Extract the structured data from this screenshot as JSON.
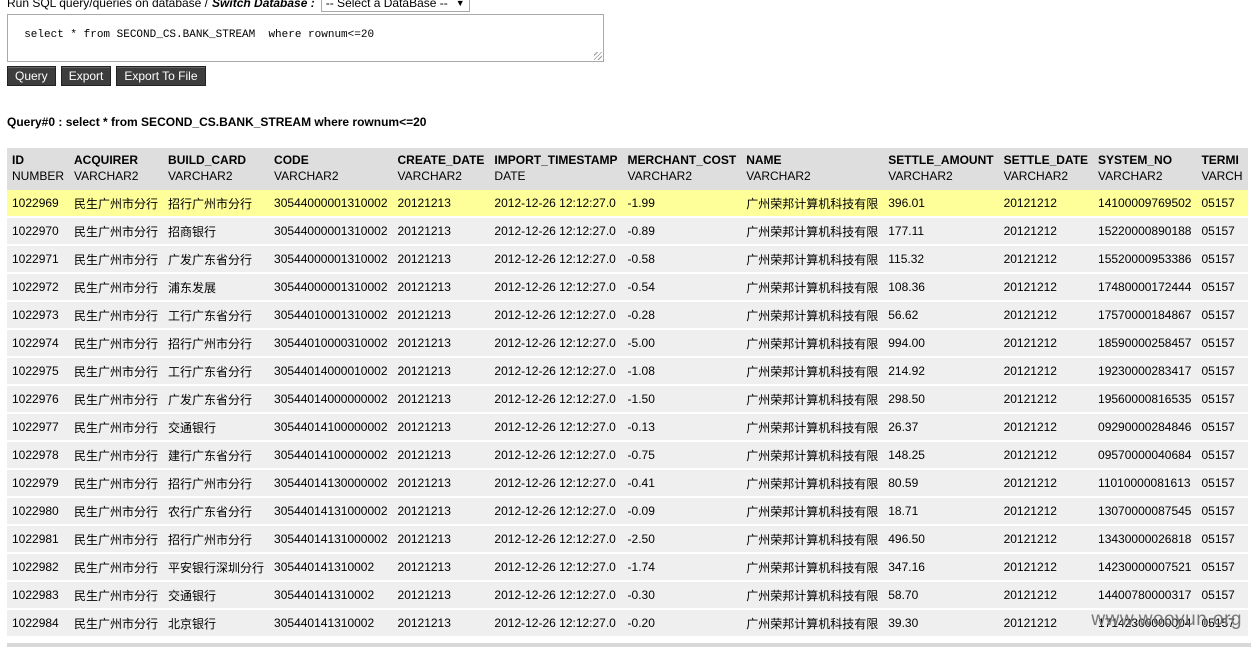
{
  "header": {
    "run_label": "Run SQL query/queries on database /",
    "switch_label": "Switch Database :",
    "db_select_value": "-- Select a DataBase --"
  },
  "sql_input": {
    "value": "select * from SECOND_CS.BANK_STREAM  where rownum<=20"
  },
  "buttons": {
    "query": "Query",
    "export": "Export",
    "export_file": "Export To File"
  },
  "result": {
    "label": "Query#0 : select * from SECOND_CS.BANK_STREAM where rownum<=20"
  },
  "columns": [
    {
      "name": "ID",
      "type": "NUMBER"
    },
    {
      "name": "ACQUIRER",
      "type": "VARCHAR2"
    },
    {
      "name": "BUILD_CARD",
      "type": "VARCHAR2"
    },
    {
      "name": "CODE",
      "type": "VARCHAR2"
    },
    {
      "name": "CREATE_DATE",
      "type": "VARCHAR2"
    },
    {
      "name": "IMPORT_TIMESTAMP",
      "type": "DATE"
    },
    {
      "name": "MERCHANT_COST",
      "type": "VARCHAR2"
    },
    {
      "name": "NAME",
      "type": "VARCHAR2"
    },
    {
      "name": "SETTLE_AMOUNT",
      "type": "VARCHAR2"
    },
    {
      "name": "SETTLE_DATE",
      "type": "VARCHAR2"
    },
    {
      "name": "SYSTEM_NO",
      "type": "VARCHAR2"
    },
    {
      "name": "TERMI",
      "type": "VARCH"
    }
  ],
  "rows": [
    [
      "1022969",
      "民生广州市分行",
      "招行广州市分行",
      "30544000001310002",
      "20121213",
      "2012-12-26 12:12:27.0",
      "-1.99",
      "广州荣邦计算机科技有限",
      "396.01",
      "20121212",
      "14100009769502",
      "05157"
    ],
    [
      "1022970",
      "民生广州市分行",
      "招商银行",
      "30544000001310002",
      "20121213",
      "2012-12-26 12:12:27.0",
      "-0.89",
      "广州荣邦计算机科技有限",
      "177.11",
      "20121212",
      "15220000890188",
      "05157"
    ],
    [
      "1022971",
      "民生广州市分行",
      "广发广东省分行",
      "30544000001310002",
      "20121213",
      "2012-12-26 12:12:27.0",
      "-0.58",
      "广州荣邦计算机科技有限",
      "115.32",
      "20121212",
      "15520000953386",
      "05157"
    ],
    [
      "1022972",
      "民生广州市分行",
      "浦东发展",
      "30544000001310002",
      "20121213",
      "2012-12-26 12:12:27.0",
      "-0.54",
      "广州荣邦计算机科技有限",
      "108.36",
      "20121212",
      "17480000172444",
      "05157"
    ],
    [
      "1022973",
      "民生广州市分行",
      "工行广东省分行",
      "30544010001310002",
      "20121213",
      "2012-12-26 12:12:27.0",
      "-0.28",
      "广州荣邦计算机科技有限",
      "56.62",
      "20121212",
      "17570000184867",
      "05157"
    ],
    [
      "1022974",
      "民生广州市分行",
      "招行广州市分行",
      "30544010000310002",
      "20121213",
      "2012-12-26 12:12:27.0",
      "-5.00",
      "广州荣邦计算机科技有限",
      "994.00",
      "20121212",
      "18590000258457",
      "05157"
    ],
    [
      "1022975",
      "民生广州市分行",
      "工行广东省分行",
      "30544014000010002",
      "20121213",
      "2012-12-26 12:12:27.0",
      "-1.08",
      "广州荣邦计算机科技有限",
      "214.92",
      "20121212",
      "19230000283417",
      "05157"
    ],
    [
      "1022976",
      "民生广州市分行",
      "广发广东省分行",
      "30544014000000002",
      "20121213",
      "2012-12-26 12:12:27.0",
      "-1.50",
      "广州荣邦计算机科技有限",
      "298.50",
      "20121212",
      "19560000816535",
      "05157"
    ],
    [
      "1022977",
      "民生广州市分行",
      "交通银行",
      "30544014100000002",
      "20121213",
      "2012-12-26 12:12:27.0",
      "-0.13",
      "广州荣邦计算机科技有限",
      "26.37",
      "20121212",
      "09290000284846",
      "05157"
    ],
    [
      "1022978",
      "民生广州市分行",
      "建行广东省分行",
      "30544014100000002",
      "20121213",
      "2012-12-26 12:12:27.0",
      "-0.75",
      "广州荣邦计算机科技有限",
      "148.25",
      "20121212",
      "09570000040684",
      "05157"
    ],
    [
      "1022979",
      "民生广州市分行",
      "招行广州市分行",
      "30544014130000002",
      "20121213",
      "2012-12-26 12:12:27.0",
      "-0.41",
      "广州荣邦计算机科技有限",
      "80.59",
      "20121212",
      "11010000081613",
      "05157"
    ],
    [
      "1022980",
      "民生广州市分行",
      "农行广东省分行",
      "30544014131000002",
      "20121213",
      "2012-12-26 12:12:27.0",
      "-0.09",
      "广州荣邦计算机科技有限",
      "18.71",
      "20121212",
      "13070000087545",
      "05157"
    ],
    [
      "1022981",
      "民生广州市分行",
      "招行广州市分行",
      "30544014131000002",
      "20121213",
      "2012-12-26 12:12:27.0",
      "-2.50",
      "广州荣邦计算机科技有限",
      "496.50",
      "20121212",
      "13430000026818",
      "05157"
    ],
    [
      "1022982",
      "民生广州市分行",
      "平安银行深圳分行",
      "305440141310002",
      "20121213",
      "2012-12-26 12:12:27.0",
      "-1.74",
      "广州荣邦计算机科技有限",
      "347.16",
      "20121212",
      "14230000007521",
      "05157"
    ],
    [
      "1022983",
      "民生广州市分行",
      "交通银行",
      "305440141310002",
      "20121213",
      "2012-12-26 12:12:27.0",
      "-0.30",
      "广州荣邦计算机科技有限",
      "58.70",
      "20121212",
      "14400780000317",
      "05157"
    ],
    [
      "1022984",
      "民生广州市分行",
      "北京银行",
      "305440141310002",
      "20121213",
      "2012-12-26 12:12:27.0",
      "-0.20",
      "广州荣邦计算机科技有限",
      "39.30",
      "20121212",
      "17142300000004",
      "05157"
    ]
  ],
  "highlight_row": 0,
  "watermark": "www.wooyun.org",
  "colors": {
    "header_bg": "#dedede",
    "row_bg": "#efefef",
    "highlight_bg": "#ffff99",
    "button_bg": "#3d3d3d"
  }
}
